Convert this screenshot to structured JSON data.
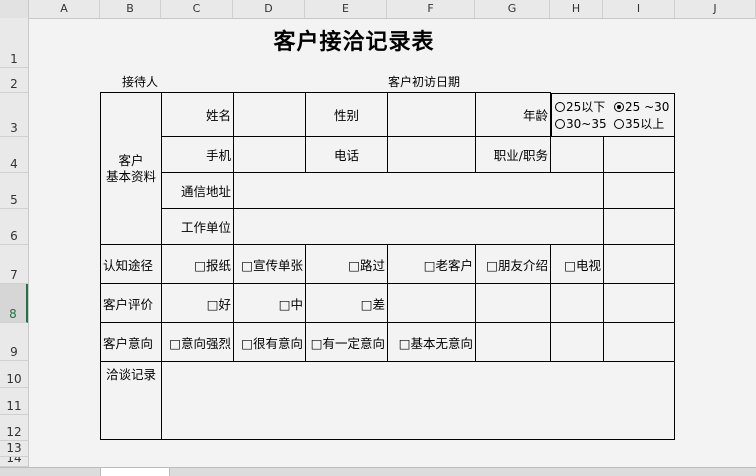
{
  "columns": [
    "A",
    "B",
    "C",
    "D",
    "E",
    "F",
    "G",
    "H",
    "I",
    "J"
  ],
  "rows": [
    "1",
    "2",
    "3",
    "4",
    "5",
    "6",
    "7",
    "8",
    "9",
    "10",
    "11",
    "12",
    "13",
    "14"
  ],
  "selected_row": "8",
  "form": {
    "title": "客户接洽记录表",
    "receptionist_label": "接待人",
    "first_visit_label": "客户初访日期",
    "customer_info_label_1": "客户",
    "customer_info_label_2": "基本资料",
    "name_label": "姓名",
    "gender_label": "性别",
    "age_label": "年龄",
    "age_options": [
      {
        "label": "25以下",
        "selected": false
      },
      {
        "label": "25 ~30",
        "selected": true
      },
      {
        "label": "30~35",
        "selected": false
      },
      {
        "label": "35以上",
        "selected": false
      }
    ],
    "mobile_label": "手机",
    "phone_label": "电话",
    "occupation_label": "职业/职务",
    "address_label": "通信地址",
    "work_unit_label": "工作单位",
    "source_label": "认知途径",
    "source_options": [
      "□报纸",
      "□宣传单张",
      "□路过",
      "□老客户",
      "□朋友介绍",
      "□电视"
    ],
    "evaluation_label": "客户评价",
    "evaluation_options": [
      "□好",
      "□中",
      "□差"
    ],
    "intent_label": "客户意向",
    "intent_options": [
      "□意向强烈",
      "□很有意向",
      "□有一定意向",
      "□基本无意向"
    ],
    "notes_label": "洽谈记录"
  }
}
